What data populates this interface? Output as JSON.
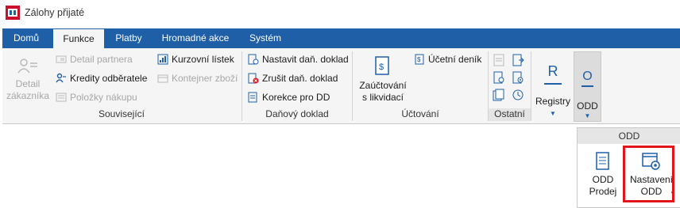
{
  "window": {
    "title": "Zálohy přijaté"
  },
  "tabs": [
    {
      "label": "Domů"
    },
    {
      "label": "Funkce"
    },
    {
      "label": "Platby"
    },
    {
      "label": "Hromadné akce"
    },
    {
      "label": "Systém"
    }
  ],
  "active_tab": "Funkce",
  "groups": {
    "souvisejici": {
      "label": "Související",
      "detail_zakaznika": [
        "Detail",
        "zákazníka"
      ],
      "detail_partnera": "Detail partnera",
      "kredity": "Kredity odběratele",
      "polozky": "Položky nákupu",
      "kurzovni": "Kurzovní lístek",
      "kontejner": "Kontejner zboží"
    },
    "danovy": {
      "label": "Daňový doklad",
      "nastavit": "Nastavit daň. doklad",
      "zrusit": "Zrušit daň. doklad",
      "korekce": "Korekce pro DD"
    },
    "uctovani": {
      "label": "Účtování",
      "zauctovani": [
        "Zaúčtování",
        "s likvidací"
      ],
      "ucetni_denik": "Účetní deník"
    },
    "ostatni": {
      "label": "Ostatní"
    },
    "registry": {
      "label": "Registry",
      "letter": "R"
    },
    "odd": {
      "label": "ODD",
      "letter": "O"
    }
  },
  "popup": {
    "title": "ODD",
    "odd_prodej": [
      "ODD",
      "Prodej"
    ],
    "nastaveni_odd": [
      "Nastavení",
      "ODD"
    ]
  },
  "colors": {
    "accent": "#1f5fa8",
    "highlight": "#e0141b"
  }
}
